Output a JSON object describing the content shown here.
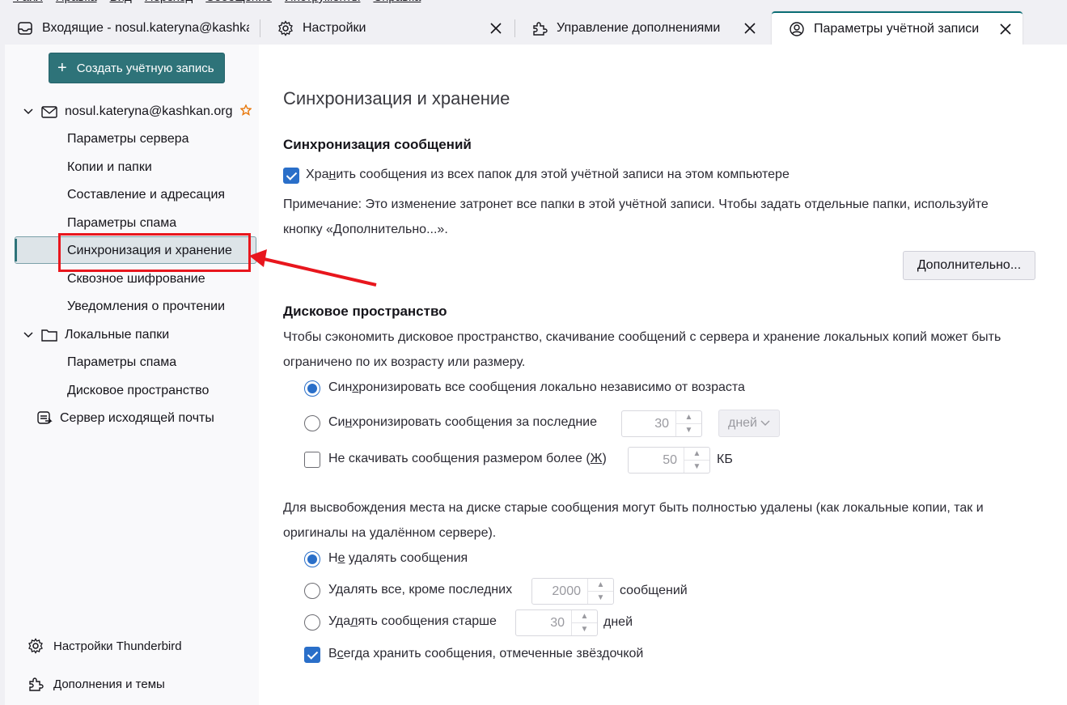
{
  "menubar": {
    "items": [
      "Файл",
      "Правка",
      "Вид",
      "Переход",
      "Сообщение",
      "Инструменты",
      "Справка"
    ]
  },
  "tabs": [
    {
      "label": "Входящие - nosul.kateryna@kashkan.org",
      "icon": "inbox-icon"
    },
    {
      "label": "Настройки",
      "icon": "gear-icon"
    },
    {
      "label": "Управление дополнениями",
      "icon": "puzzle-icon"
    },
    {
      "label": "Параметры учётной записи",
      "icon": "account-icon"
    }
  ],
  "sidebar": {
    "create_account": "Создать учётную запись",
    "account_email": "nosul.kateryna@kashkan.org",
    "account_items": [
      "Параметры сервера",
      "Копии и папки",
      "Составление и адресация",
      "Параметры спама",
      "Синхронизация и хранение",
      "Сквозное шифрование",
      "Уведомления о прочтении"
    ],
    "local_folders": "Локальные папки",
    "local_items": [
      "Параметры спама",
      "Дисковое пространство"
    ],
    "outgoing_server": "Сервер исходящей почты",
    "settings": "Настройки Thunderbird",
    "addons": "Дополнения и темы"
  },
  "main": {
    "title": "Синхронизация и хранение",
    "sync_heading": "Синхронизация сообщений",
    "keep_messages_pre": "Хра",
    "keep_messages_u": "н",
    "keep_messages_post": "ить сообщения из всех папок для этой учётной записи на этом компьютере",
    "note_line1": "Примечание: Это изменение затронет все папки в этой учётной записи. Чтобы задать отдельные папки, используйте",
    "note_line2": "кнопку «Дополнительно...».",
    "advanced_pre": "",
    "advanced_u": "Д",
    "advanced_post": "ополнительно...",
    "disk_heading": "Дисковое пространство",
    "disk_desc1": "Чтобы сэкономить дисковое пространство, скачивание сообщений с сервера и хранение локальных копий может быть",
    "disk_desc2": "ограничено по их возрасту или размеру.",
    "sync_all_pre": "Син",
    "sync_all_u": "х",
    "sync_all_post": "ронизировать все сообщения локально независимо от возраста",
    "sync_last_pre": "Си",
    "sync_last_u": "н",
    "sync_last_post": "хронизировать сообщения за последние",
    "sync_last_value": "30",
    "sync_last_unit": "дней",
    "no_download_label": "Не скачивать сообщения размером более (",
    "no_download_u": "Ж",
    "no_download_close": ")",
    "no_download_value": "50",
    "no_download_unit": "КБ",
    "delete_desc1": "Для высвобождения места на диске старые сообщения могут быть полностью удалены (как локальные копии, так и",
    "delete_desc2": "оригиналы на удалённом сервере).",
    "no_delete_pre": "Н",
    "no_delete_u": "е",
    "no_delete_post": " удалять сообщения",
    "delete_all_pre": "Удалять все, кроме после",
    "delete_all_u": "д",
    "delete_all_post": "них",
    "delete_all_value": "2000",
    "delete_all_unit": "сообщений",
    "delete_older_pre": "Уда",
    "delete_older_u": "л",
    "delete_older_post": "ять сообщения старше",
    "delete_older_value": "30",
    "delete_older_unit": "дней",
    "keep_starred_pre": "В",
    "keep_starred_u": "с",
    "keep_starred_post": "егда хранить сообщения, отмеченные звёздочкой"
  },
  "colors": {
    "accent": "#2e7379",
    "checkbox": "#2a6fc9",
    "annotation": "#e8161d"
  }
}
